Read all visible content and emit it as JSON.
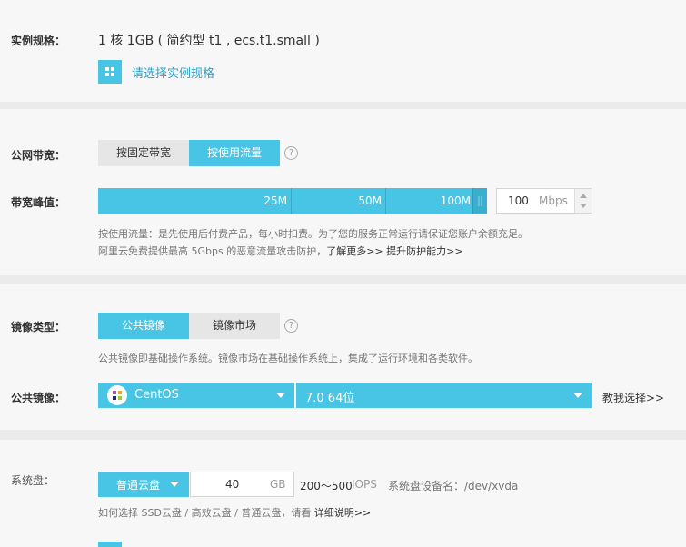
{
  "instance": {
    "label": "实例规格：",
    "value": "1 核 1GB ( 简约型 t1 , ecs.t1.small )",
    "select_link": "请选择实例规格",
    "icon": "grid-icon"
  },
  "network": {
    "label": "公网带宽：",
    "options": [
      "按固定带宽",
      "按使用流量"
    ],
    "selected": "按使用流量",
    "help": "?",
    "peak_label": "带宽峰值：",
    "ticks": [
      "25M",
      "50M",
      "100M"
    ],
    "slider_value_mbps": 100,
    "input_value": "100",
    "unit": "Mbps",
    "note_line1": "按使用流量：是先使用后付费产品，每小时扣费。为了您的服务正常运行请保证您账户余额充足。",
    "note_line2_prefix": "阿里云免费提供最高 5Gbps 的恶意流量攻击防护，",
    "learn_more": "了解更多>>",
    "improve": "提升防护能力>>"
  },
  "image": {
    "label": "镜像类型：",
    "options": [
      "公共镜像",
      "镜像市场"
    ],
    "selected": "公共镜像",
    "help": "?",
    "note": "公共镜像即基础操作系统。镜像市场在基础操作系统上，集成了运行环境和各类软件。",
    "public_label": "公共镜像：",
    "os": "CentOS",
    "os_icon": "centos-logo-icon",
    "version": "7.0 64位",
    "teach_link": "教我选择>>"
  },
  "disk": {
    "label": "系统盘：",
    "type": "普通云盘",
    "size": "40",
    "unit": "GB",
    "iops_value": "200～500",
    "iops_unit": "IOPS",
    "device_label": "系统盘设备名：/dev/xvda",
    "note_prefix": "如何选择 SSD云盘 / 高效云盘 / 普通云盘，请看",
    "detail_link": "详细说明>>"
  },
  "colors": {
    "accent": "#48c5e5",
    "panel": "#f7f7f7",
    "gap": "#ebebeb"
  }
}
